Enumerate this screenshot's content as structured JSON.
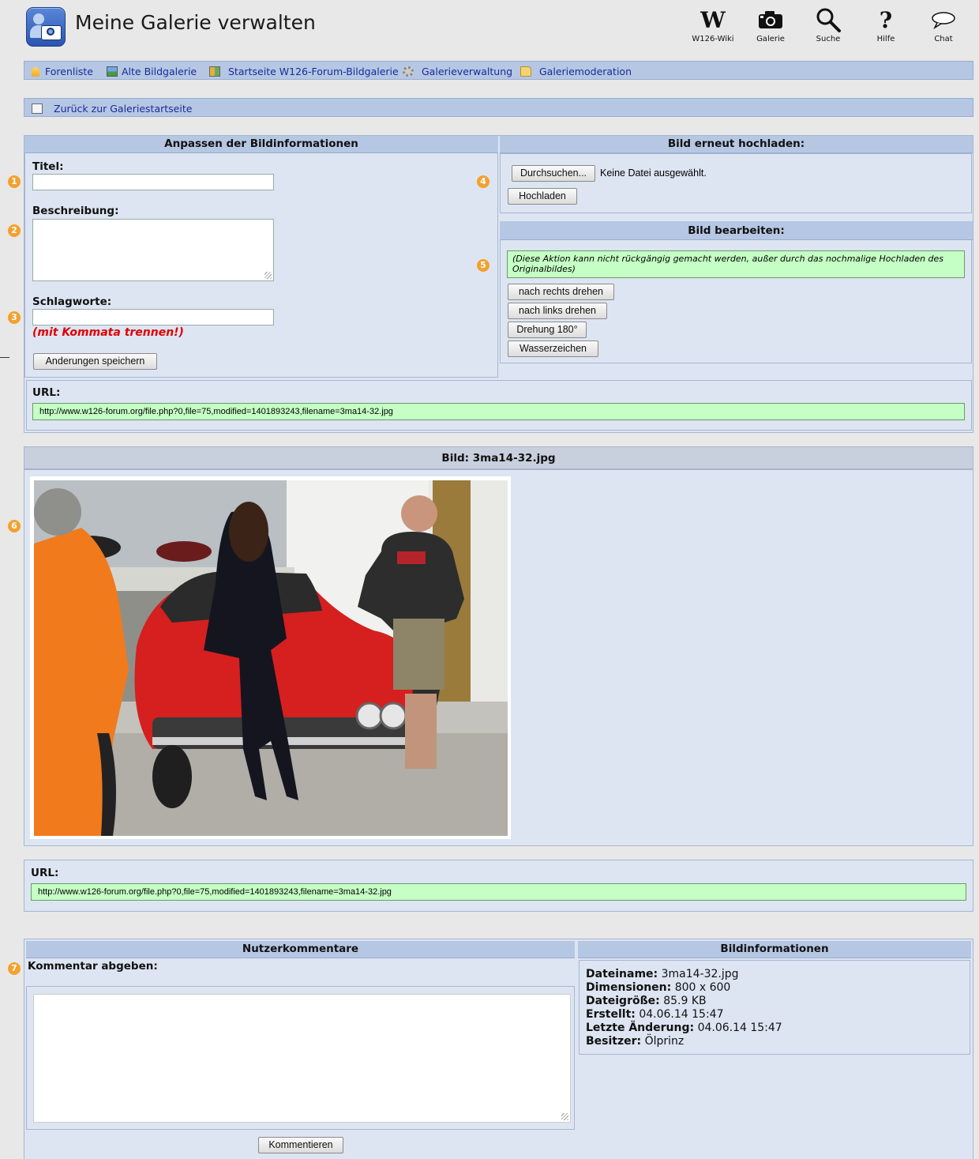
{
  "header": {
    "title": "Meine Galerie verwalten",
    "nav": [
      {
        "label": "W126-Wiki",
        "icon": "wiki-icon",
        "glyph": "W"
      },
      {
        "label": "Galerie",
        "icon": "camera-icon",
        "glyph": ""
      },
      {
        "label": "Suche",
        "icon": "search-icon",
        "glyph": ""
      },
      {
        "label": "Hilfe",
        "icon": "help-icon",
        "glyph": "?"
      },
      {
        "label": "Chat",
        "icon": "chat-icon",
        "glyph": ""
      }
    ]
  },
  "breadcrumbs": [
    {
      "label": "Forenliste",
      "icon": "home-icon"
    },
    {
      "label": "Alte Bildgalerie",
      "icon": "picture-icon"
    },
    {
      "label": "Startseite W126-Forum-Bildgalerie",
      "icon": "gallery-icon"
    },
    {
      "label": "Galerieverwaltung",
      "icon": "gear-icon"
    },
    {
      "label": "Galeriemoderation",
      "icon": "folder-icon"
    }
  ],
  "back_link": "Zurück zur Galeriestartseite",
  "edit_info": {
    "heading": "Anpassen der Bildinformationen",
    "title_label": "Titel:",
    "title_value": "",
    "description_label": "Beschreibung:",
    "description_value": "",
    "tags_label": "Schlagworte:",
    "tags_value": "",
    "tags_hint": "(mit Kommata trennen!)",
    "save_button": "Anderungen speichern",
    "url_label": "URL:",
    "url": "http://www.w126-forum.org/file.php?0,file=75,modified=1401893243,filename=3ma14-32.jpg"
  },
  "reupload": {
    "heading": "Bild erneut hochladen:",
    "browse_button": "Durchsuchen...",
    "no_file": "Keine Datei ausgewählt.",
    "upload_button": "Hochladen"
  },
  "edit_image": {
    "heading": "Bild bearbeiten:",
    "warning": "(Diese Aktion kann nicht rückgängig gemacht werden, außer durch das nochmalige Hochladen des Originalbildes)",
    "buttons": [
      "nach rechts drehen",
      "nach links drehen",
      "Drehung 180°",
      "Wasserzeichen"
    ]
  },
  "image_section": {
    "heading": "Bild: 3ma14-32.jpg",
    "url_label": "URL:",
    "url": "http://www.w126-forum.org/file.php?0,file=75,modified=1401893243,filename=3ma14-32.jpg"
  },
  "comments": {
    "heading": "Nutzerkommentare",
    "label": "Kommentar abgeben:",
    "value": "",
    "submit": "Kommentieren"
  },
  "image_info": {
    "heading": "Bildinformationen",
    "rows": [
      {
        "key": "Dateiname:",
        "value": "3ma14-32.jpg"
      },
      {
        "key": "Dimensionen:",
        "value": "800 x 600"
      },
      {
        "key": "Dateigröße:",
        "value": "85.9 KB"
      },
      {
        "key": "Erstellt:",
        "value": "04.06.14 15:47"
      },
      {
        "key": "Letzte Änderung:",
        "value": "04.06.14 15:47"
      },
      {
        "key": "Besitzer:",
        "value": "Ölprinz"
      }
    ]
  },
  "markers": [
    "1",
    "2",
    "3",
    "4",
    "5",
    "6",
    "7"
  ],
  "colors": {
    "bar": "#b5c7e3",
    "panel": "#dde5f2",
    "url_box": "#c5ffc5",
    "marker": "#f3a12e",
    "hint": "#e00000",
    "link": "#1d2a9a"
  }
}
